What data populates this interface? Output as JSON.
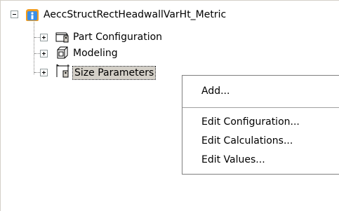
{
  "tree": {
    "root": {
      "label": "AeccStructRectHeadwallVarHt_Metric",
      "icon": "part-family-icon",
      "expanded": true
    },
    "children": [
      {
        "label": "Part Configuration",
        "icon": "part-configuration-icon",
        "expanded": false
      },
      {
        "label": "Modeling",
        "icon": "modeling-icon",
        "expanded": false
      },
      {
        "label": "Size Parameters",
        "icon": "size-parameters-icon",
        "expanded": false,
        "selected": true
      }
    ]
  },
  "context_menu": {
    "items": [
      "Add...",
      "Edit Configuration...",
      "Edit Calculations...",
      "Edit Values..."
    ]
  },
  "colors": {
    "selection": "#d4d0c8",
    "accent": "#3a8ee6",
    "icon_accent": "#f29b1c"
  }
}
